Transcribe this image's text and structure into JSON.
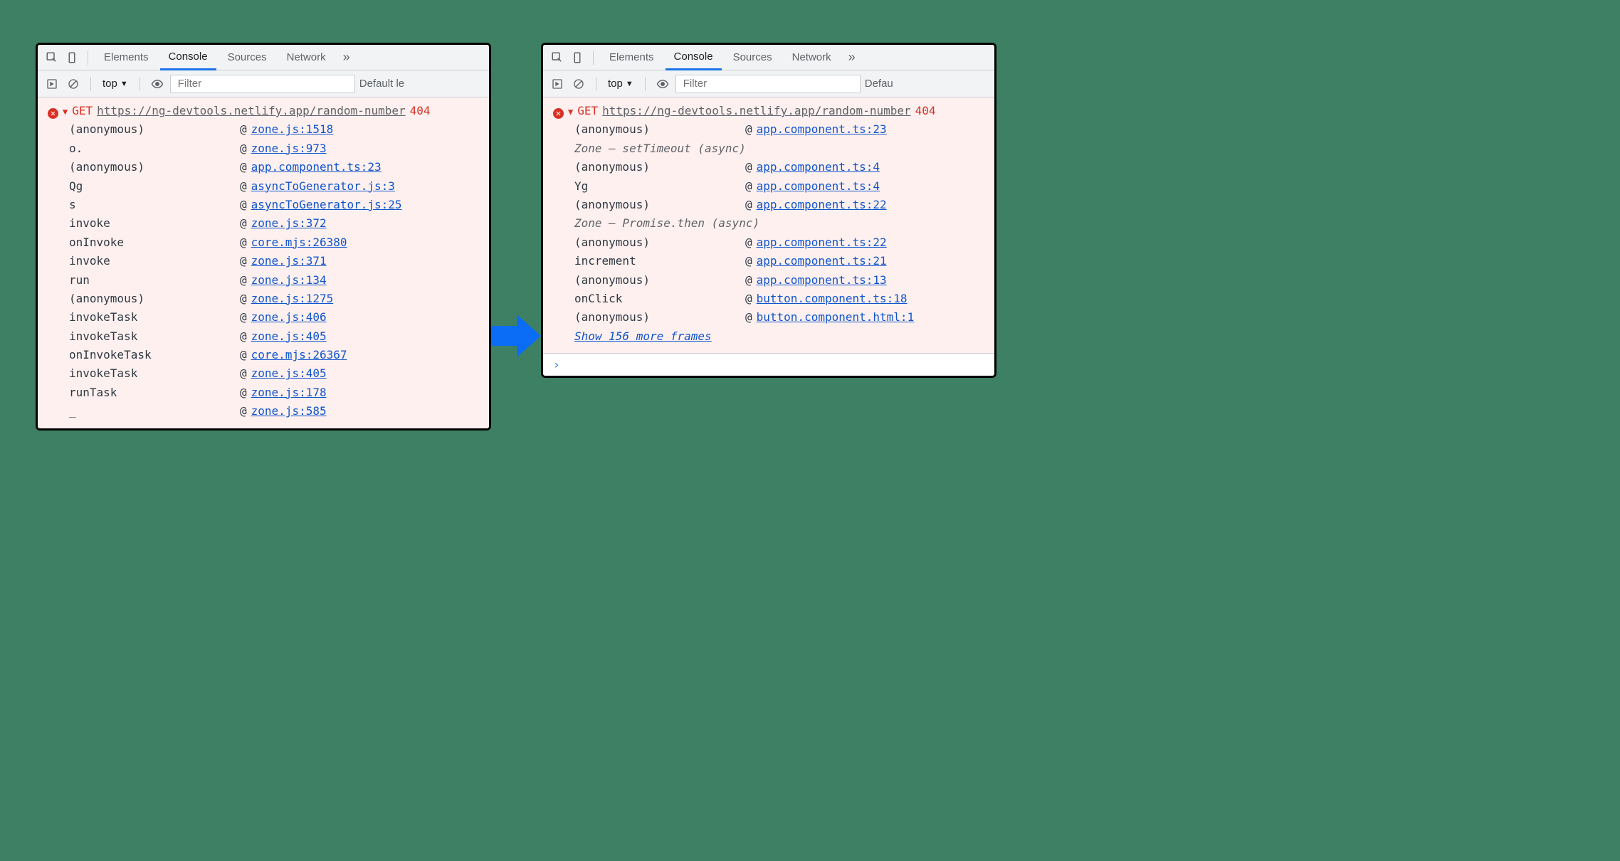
{
  "tabs": [
    "Elements",
    "Console",
    "Sources",
    "Network"
  ],
  "activeTab": "Console",
  "subbar": {
    "context": "top",
    "filter_placeholder": "Filter",
    "levels": "Default le"
  },
  "subbar_right_levels": "Defau",
  "error": {
    "method": "GET",
    "url": "https://ng-devtools.netlify.app/random-number",
    "status": "404"
  },
  "left_stack": [
    {
      "fn": "(anonymous)",
      "link": "zone.js:1518"
    },
    {
      "fn": "o.<computed>",
      "link": "zone.js:973"
    },
    {
      "fn": "(anonymous)",
      "link": "app.component.ts:23"
    },
    {
      "fn": "Qg",
      "link": "asyncToGenerator.js:3"
    },
    {
      "fn": "s",
      "link": "asyncToGenerator.js:25"
    },
    {
      "fn": "invoke",
      "link": "zone.js:372"
    },
    {
      "fn": "onInvoke",
      "link": "core.mjs:26380"
    },
    {
      "fn": "invoke",
      "link": "zone.js:371"
    },
    {
      "fn": "run",
      "link": "zone.js:134"
    },
    {
      "fn": "(anonymous)",
      "link": "zone.js:1275"
    },
    {
      "fn": "invokeTask",
      "link": "zone.js:406"
    },
    {
      "fn": "invokeTask",
      "link": "zone.js:405"
    },
    {
      "fn": "onInvokeTask",
      "link": "core.mjs:26367"
    },
    {
      "fn": "invokeTask",
      "link": "zone.js:405"
    },
    {
      "fn": "runTask",
      "link": "zone.js:178"
    },
    {
      "fn": "_",
      "link": "zone.js:585"
    }
  ],
  "right_blocks": [
    {
      "type": "frame",
      "fn": "(anonymous)",
      "link": "app.component.ts:23"
    },
    {
      "type": "zone",
      "label": "Zone — setTimeout (async)"
    },
    {
      "type": "frame",
      "fn": "(anonymous)",
      "link": "app.component.ts:4"
    },
    {
      "type": "frame",
      "fn": "Yg",
      "link": "app.component.ts:4"
    },
    {
      "type": "frame",
      "fn": "(anonymous)",
      "link": "app.component.ts:22"
    },
    {
      "type": "zone",
      "label": "Zone — Promise.then (async)"
    },
    {
      "type": "frame",
      "fn": "(anonymous)",
      "link": "app.component.ts:22"
    },
    {
      "type": "frame",
      "fn": "increment",
      "link": "app.component.ts:21"
    },
    {
      "type": "frame",
      "fn": "(anonymous)",
      "link": "app.component.ts:13"
    },
    {
      "type": "frame",
      "fn": "onClick",
      "link": "button.component.ts:18"
    },
    {
      "type": "frame",
      "fn": "(anonymous)",
      "link": "button.component.html:1"
    }
  ],
  "show_more": "Show 156 more frames"
}
